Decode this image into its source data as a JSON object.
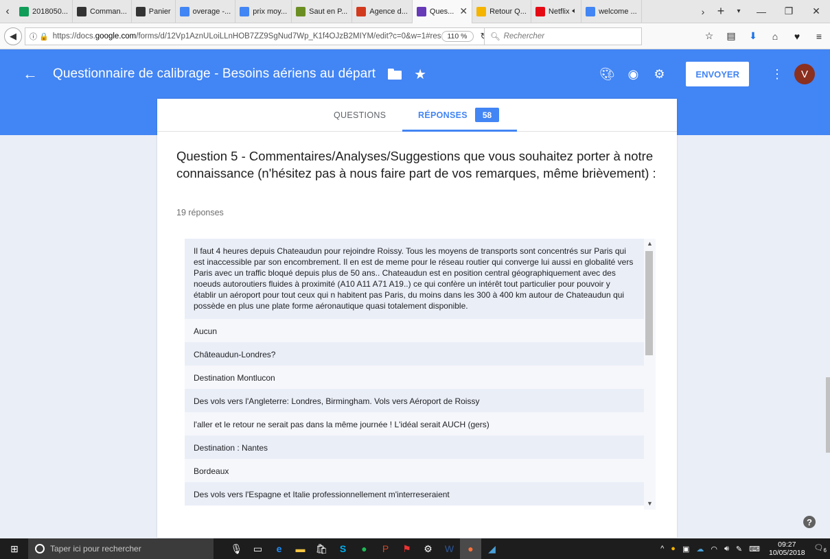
{
  "browser": {
    "tabs": [
      {
        "label": "2018050...",
        "icon": "sheets-icon",
        "color": "#0f9d58"
      },
      {
        "label": "Comman...",
        "icon": "circle-g-icon",
        "color": "#333333"
      },
      {
        "label": "Panier",
        "icon": "circle-g-icon",
        "color": "#333333"
      },
      {
        "label": "overage -...",
        "icon": "google-icon",
        "color": "#4285f4"
      },
      {
        "label": "prix moy...",
        "icon": "google-icon",
        "color": "#4285f4"
      },
      {
        "label": "Saut en P...",
        "icon": "parachute-icon",
        "color": "#6b8e23"
      },
      {
        "label": "Agence d...",
        "icon": "agency-icon",
        "color": "#d23a1e"
      },
      {
        "label": "Ques...",
        "icon": "forms-icon",
        "color": "#673ab7",
        "active": true
      },
      {
        "label": "Retour Q...",
        "icon": "pencil-icon",
        "color": "#f4b400"
      },
      {
        "label": "Netflix",
        "icon": "netflix-icon",
        "color": "#e50914"
      },
      {
        "label": "welcome ...",
        "icon": "google-icon",
        "color": "#4285f4"
      }
    ],
    "url_prefix": "https://docs.",
    "url_domain": "google.com",
    "url_rest": "/forms/d/12Vp1AznULoiLLnHOB7ZZ9SgNud7Wp_K1f4OJzB2MIYM/edit?c=0&w=1#res",
    "zoom": "110 %",
    "search_placeholder": "Rechercher"
  },
  "form": {
    "title": "Questionnaire de calibrage - Besoins aériens au départ",
    "send_label": "ENVOYER",
    "avatar_letter": "V",
    "accent": "#4285f4",
    "tabs": {
      "questions": "QUESTIONS",
      "responses": "RÉPONSES",
      "response_count": "58"
    }
  },
  "question": {
    "title": "Question 5 - Commentaires/Analyses/Suggestions que vous souhaitez porter à notre connaissance (n'hésitez pas à nous faire part de vos remarques, même brièvement) :",
    "count": "19 réponses",
    "answers": [
      "Il faut 4 heures depuis Chateaudun pour rejoindre Roissy. Tous les moyens de transports sont concentrés sur Paris qui est inaccessible par son encombrement. Il en est de meme pour le réseau routier qui converge lui aussi en globalité vers Paris avec un traffic bloqué depuis plus de 50 ans.. Chateaudun est en position central géographiquement avec des noeuds autoroutiers fluides à proximité (A10 A11 A71 A19..) ce qui confère un intérêt tout particulier pour pouvoir y établir un aéroport pour tout ceux qui n habitent pas Paris, du moins dans les 300 à 400 km autour de Chateaudun qui possède en plus une plate forme aéronautique quasi totalement disponible.",
      "Aucun",
      "Châteaudun-Londres?",
      "Destination Montlucon",
      "Des vols vers l'Angleterre: Londres, Birmingham. Vols vers Aéroport de Roissy",
      "l'aller et le retour ne serait pas dans la même journée ! L'idéal serait AUCH (gers)",
      "Destination : Nantes",
      "Bordeaux",
      "Des vols vers l'Espagne et Italie professionnellement m'interreseraient"
    ]
  },
  "taskbar": {
    "search_placeholder": "Taper ici pour rechercher",
    "time": "09:27",
    "date": "10/05/2018",
    "notifications": "6"
  }
}
